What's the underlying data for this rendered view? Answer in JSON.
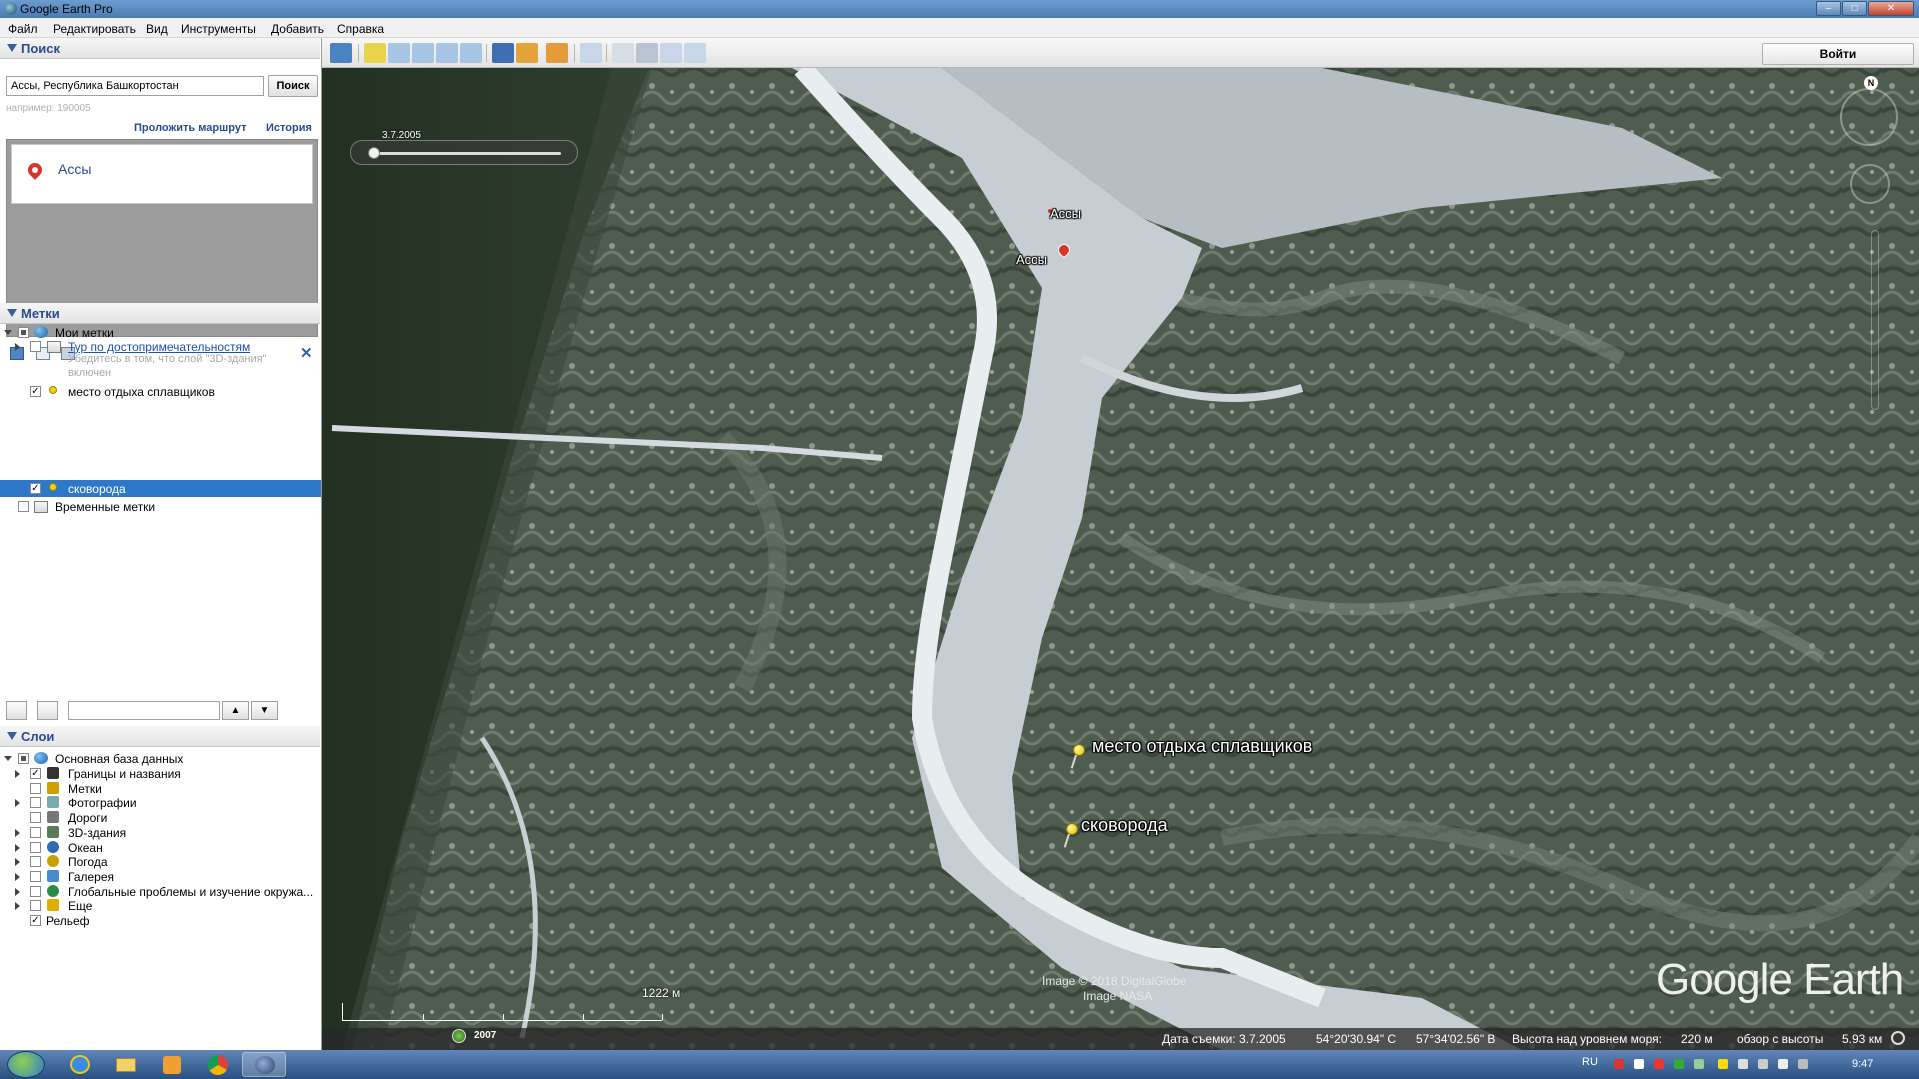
{
  "window": {
    "title": "Google Earth Pro"
  },
  "menu": {
    "items": [
      "Файл",
      "Редактировать",
      "Вид",
      "Инструменты",
      "Добавить",
      "Справка"
    ]
  },
  "search": {
    "header": "Поиск",
    "value": "Ассы, Республика Башкортостан",
    "button": "Поиск",
    "hint": "например: 190005",
    "route_link": "Проложить маршрут",
    "history_link": "История",
    "results": [
      {
        "title": "Ассы"
      }
    ]
  },
  "places": {
    "header": "Метки",
    "my_places": "Мои метки",
    "tour_link": "Тур по достопримечательностям",
    "tour_note_line1": "Убедитесь в том, что слой \"3D-здания\"",
    "tour_note_line2": "включен",
    "item_rest": "место отдыха сплавщиков",
    "item_skovoroda": "сковорода",
    "temp_places": "Временные метки"
  },
  "layers": {
    "header": "Слои",
    "root": "Основная база данных",
    "items": [
      {
        "label": "Границы и названия",
        "checked": true
      },
      {
        "label": "Метки",
        "checked": false
      },
      {
        "label": "Фотографии",
        "checked": false
      },
      {
        "label": "Дороги",
        "checked": false
      },
      {
        "label": "3D-здания",
        "checked": false
      },
      {
        "label": "Океан",
        "checked": false
      },
      {
        "label": "Погода",
        "checked": false
      },
      {
        "label": "Галерея",
        "checked": false
      },
      {
        "label": "Глобальные проблемы и изучение окружа...",
        "checked": false
      },
      {
        "label": "Еще",
        "checked": false
      },
      {
        "label": "Рельеф",
        "checked": true
      }
    ]
  },
  "toolbar": {
    "signin": "Войти"
  },
  "map": {
    "time_label": "3.7.2005",
    "labels": {
      "assy1": "Ассы",
      "assy2": "Ассы",
      "rest": "место отдыха сплавщиков",
      "skovoroda": "сковорода"
    },
    "compass_n": "N",
    "scale_label": "1222 м",
    "year_badge": "2007",
    "credit1": "Image © 2018 DigitalGlobe",
    "credit2": "Image NASA",
    "logo": "Google Earth"
  },
  "status": {
    "date": "Дата съемки: 3.7.2005",
    "lat": "54°20'30.94\" С",
    "lon": "57°34'02.56\" В",
    "elevation_label": "Высота над уровнем моря:",
    "elevation_value": "220 м",
    "eye_label": "обзор с высоты",
    "eye_value": "5.93 км"
  },
  "taskbar": {
    "lang": "RU",
    "time": "9:47"
  }
}
